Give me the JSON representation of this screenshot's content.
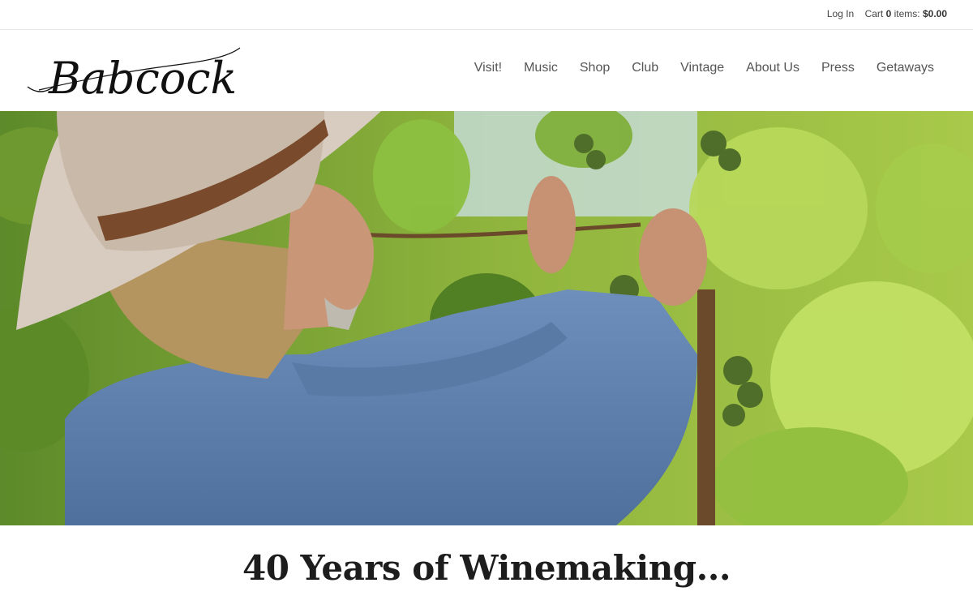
{
  "utility": {
    "login": "Log In",
    "cart_label": "Cart",
    "cart_count": "0",
    "items_label": "items:",
    "cart_total": "$0.00"
  },
  "brand": {
    "logo_text": "Babcock"
  },
  "nav": {
    "items": [
      "Visit!",
      "Music",
      "Shop",
      "Club",
      "Vintage",
      "About Us",
      "Press",
      "Getaways"
    ]
  },
  "hero": {
    "image": "winemaker-in-hat-inspecting-grapevines"
  },
  "headline": "40 Years of Winemaking..."
}
